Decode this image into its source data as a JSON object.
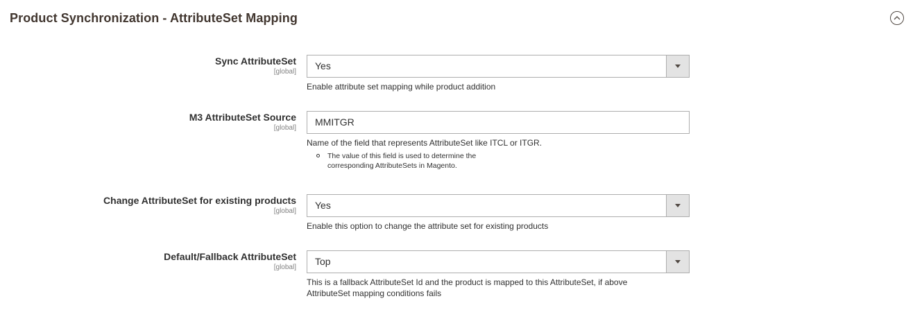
{
  "section": {
    "title": "Product Synchronization - AttributeSet Mapping"
  },
  "fields": {
    "sync": {
      "label": "Sync AttributeSet",
      "scope": "[global]",
      "value": "Yes",
      "note": "Enable attribute set mapping while product addition"
    },
    "source": {
      "label": "M3 AttributeSet Source",
      "scope": "[global]",
      "value": "MMITGR",
      "note": "Name of the field that represents AttributeSet like ITCL or ITGR.",
      "note_items": [
        "The value of this field is used to determine the corresponding AttributeSets in Magento."
      ]
    },
    "change": {
      "label": "Change AttributeSet for existing products",
      "scope": "[global]",
      "value": "Yes",
      "note": "Enable this option to change the attribute set for existing products"
    },
    "fallback": {
      "label": "Default/Fallback AttributeSet",
      "scope": "[global]",
      "value": "Top",
      "note": "This is a fallback AttributeSet Id and the product is mapped to this AttributeSet, if above AttributeSet mapping conditions fails"
    }
  }
}
